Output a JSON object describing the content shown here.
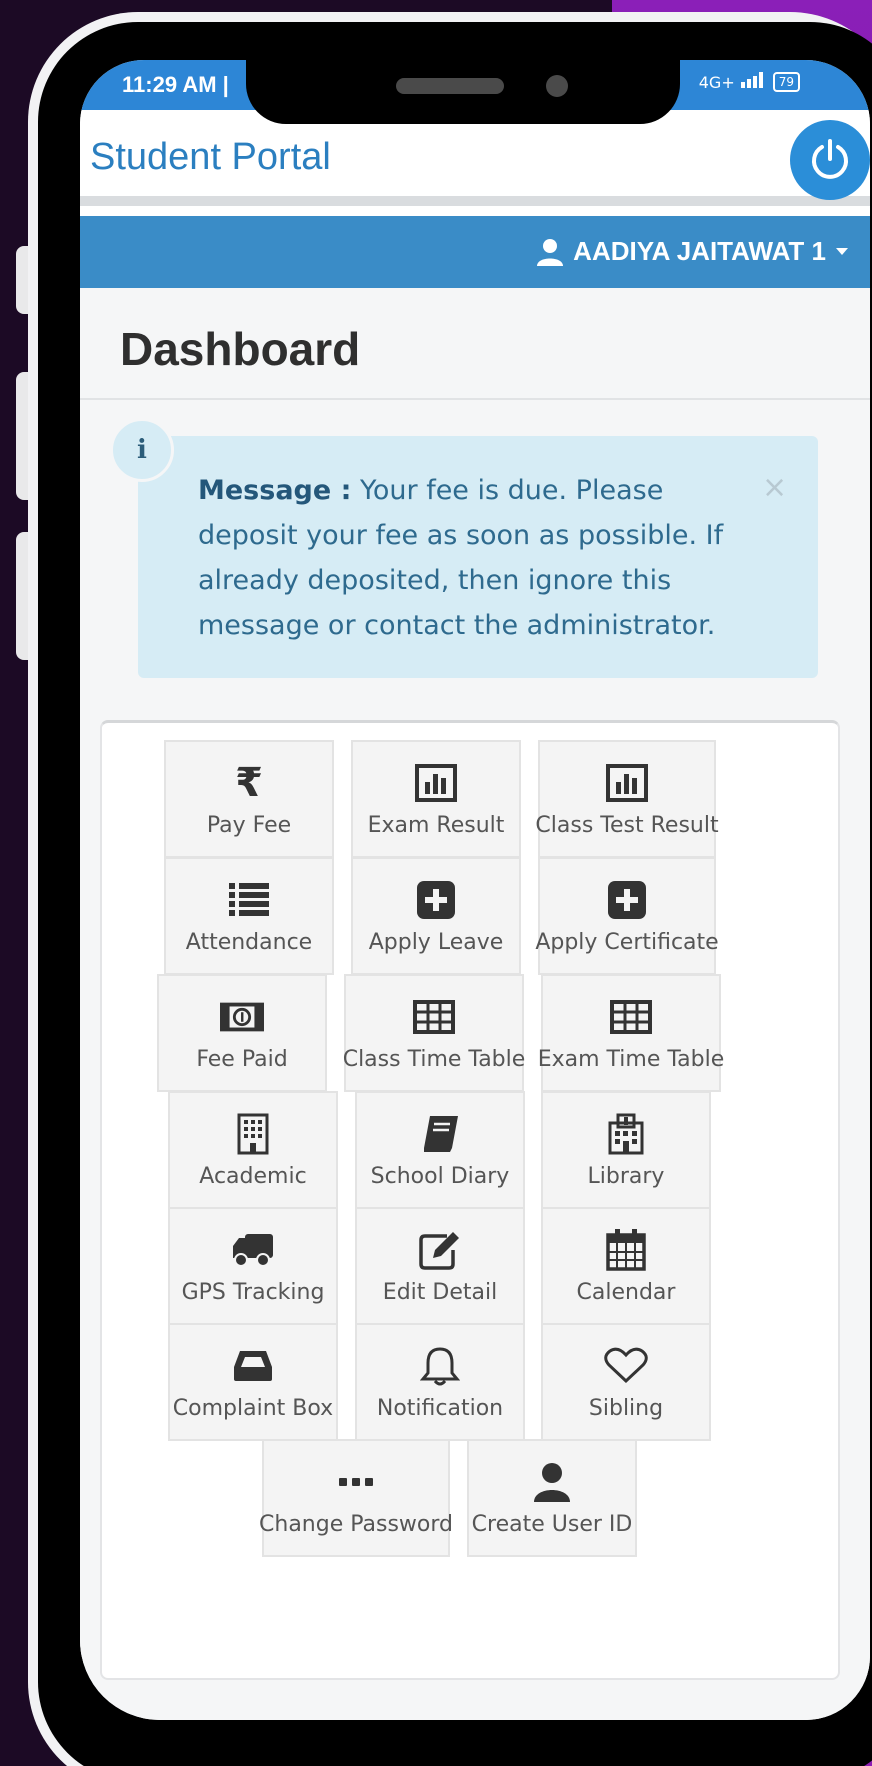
{
  "status_bar": {
    "time": "11:29 AM |",
    "network": "4G+",
    "battery": "79"
  },
  "header": {
    "title": "Student Portal"
  },
  "user": {
    "name": "AADIYA JAITAWAT 1"
  },
  "page": {
    "title": "Dashboard"
  },
  "alert": {
    "label": "Message :",
    "text": " Your fee is due. Please deposit your fee as soon as possible. If already deposited, then ignore this message or contact the administrator.",
    "close": "×",
    "icon": "i"
  },
  "tiles": {
    "pay_fee": "Pay Fee",
    "exam_result": "Exam Result",
    "class_test_result": "Class Test Result",
    "attendance": "Attendance",
    "apply_leave": "Apply Leave",
    "apply_certificate": "Apply Certificate",
    "fee_paid": "Fee Paid",
    "class_time_table": "Class Time Table",
    "exam_time_table": "Exam Time Table",
    "academic": "Academic",
    "school_diary": "School Diary",
    "library": "Library",
    "gps_tracking": "GPS Tracking",
    "edit_detail": "Edit Detail",
    "calendar": "Calendar",
    "complaint_box": "Complaint Box",
    "notification": "Notification",
    "sibling": "Sibling",
    "change_password": "Change Password",
    "create_user_id": "Create User ID"
  },
  "icons": {
    "rupee": "₹"
  },
  "colors": {
    "primary": "#2b7fc0",
    "userbar": "#3a8cc7",
    "alert_bg": "#d6ecf5",
    "accent_purple": "#8b1fb8"
  }
}
